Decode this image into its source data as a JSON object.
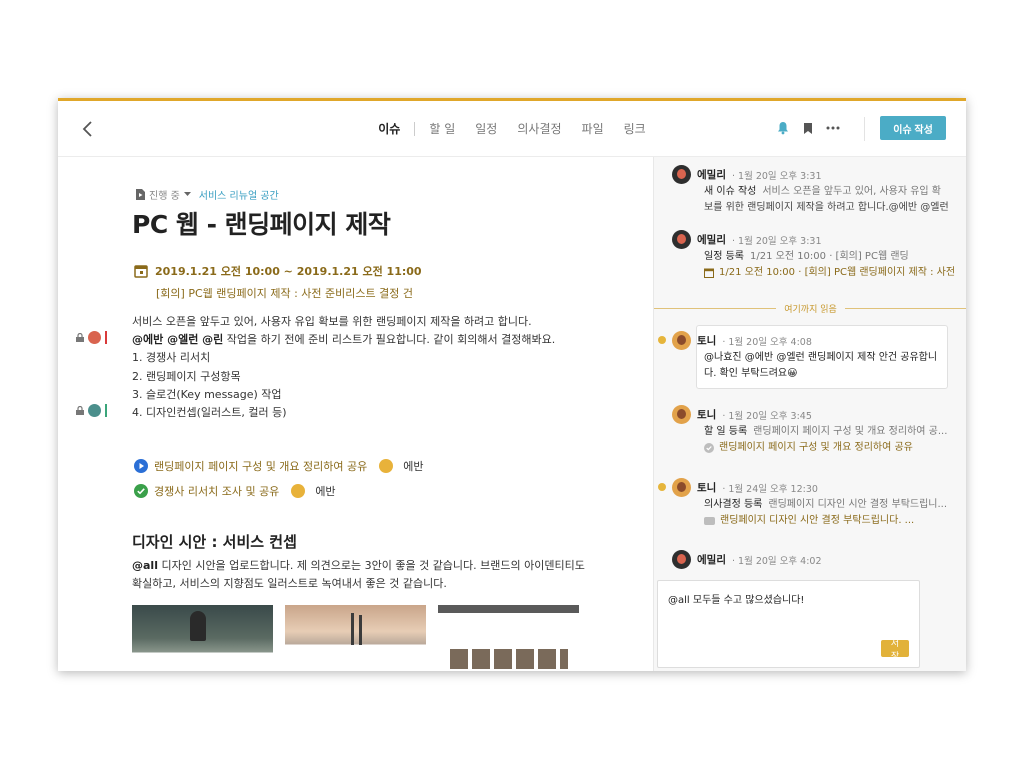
{
  "header": {
    "tabs": [
      {
        "label": "이슈",
        "active": true
      },
      {
        "label": "할 일"
      },
      {
        "label": "일정"
      },
      {
        "label": "의사결정"
      },
      {
        "label": "파일"
      },
      {
        "label": "링크"
      }
    ],
    "create_button": "이슈 작성",
    "icons": [
      "back-icon",
      "bell-icon",
      "bookmark-icon",
      "more-icon"
    ]
  },
  "issue": {
    "status": "진행 중",
    "space": "서비스 리뉴얼 공간",
    "title": "PC 웹 - 랜딩페이지 제작",
    "event": {
      "datetime": "2019.1.21  오전 10:00  ~  2019.1.21  오전 11:00",
      "name": "[회의] PC웹 랜딩페이지 제작 : 사전 준비리스트 결정 건"
    },
    "body": {
      "line1": "서비스 오픈을 앞두고 있어, 사용자 유입 확보를 위한 랜딩페이지 제작을 하려고 합니다.",
      "line2_mentions": "@에반 @엘런 @린",
      "line2_rest": " 작업을 하기 전에 준비 리스트가 필요합니다. 같이 회의해서 결정해봐요.",
      "items": [
        "1. 경쟁사 리서치",
        "2. 랜딩페이지 구성항목",
        "3. 슬로건(Key message) 작업",
        "4. 디자인컨셉(일러스트, 컬러 등)"
      ]
    },
    "todos": [
      {
        "text": "랜딩페이지 페이지 구성 및 개요 정리하여 공유",
        "assignee": "에반",
        "done": false
      },
      {
        "text": "경쟁사 리서치 조사 및 공유",
        "assignee": "에반",
        "done": true
      }
    ],
    "section2": {
      "heading": "디자인 시안 : 서비스 컨셉",
      "mention": "@all",
      "line1": " 디자인 시안을 업로드합니다. 제 의견으로는 3안이 좋을 것 같습니다. 브랜드의 아이덴티티도",
      "line2": "확실하고, 서비스의 지향점도 일러스트로 녹여내서 좋은 것 같습니다."
    }
  },
  "feed": {
    "items": [
      {
        "name": "에밀리",
        "time": "1월 20일 오후 3:31",
        "kw": "새 이슈 작성",
        "l1": "서비스 오픈을 앞두고 있어, 사용자 유입 확",
        "l2": "보를 위한 랜딩페이지 제작을 하려고 합니다.@에반 @엘런"
      },
      {
        "name": "에밀리",
        "time": "1월 20일 오후 3:31",
        "kw": "일정 등록",
        "l1": "1/21 오전 10:00 · [회의] PC웹 랜딩",
        "link": "1/21 오전 10:00 · [회의] PC웹 랜딩페이지 제작 : 사전"
      },
      {
        "name": "토니",
        "time": "1월 20일 오후 4:08",
        "l1": "@나효진 @에반 @엘런 랜딩페이지 제작 안건 공유합니",
        "l2": "다. 확인 부탁드려요😀"
      },
      {
        "name": "토니",
        "time": "1월 20일 오후 3:45",
        "kw": "할 일 등록",
        "l1": "랜딩페이지 페이지 구성 및 개요 정리하여 공...",
        "link": "랜딩페이지 페이지 구성 및 개요 정리하여 공유"
      },
      {
        "name": "토니",
        "time": "1월 24일 오후 12:30",
        "kw": "의사결정 등록",
        "l1": "랜딩페이지 디자인 시안 결정 부탁드립니...",
        "link": "랜딩페이지 디자인 시안 결정 부탁드립니다. ..."
      },
      {
        "name": "에밀리",
        "time": "1월 20일 오후 4:02"
      }
    ],
    "read_marker": "여기까지 읽음",
    "compose_text": "@all 모두들 수고 많으셨습니다!",
    "save_label": "저장"
  },
  "colors": {
    "accent": "#e0a72a",
    "primary": "#4bacc6",
    "event": "#8a6a1a"
  }
}
